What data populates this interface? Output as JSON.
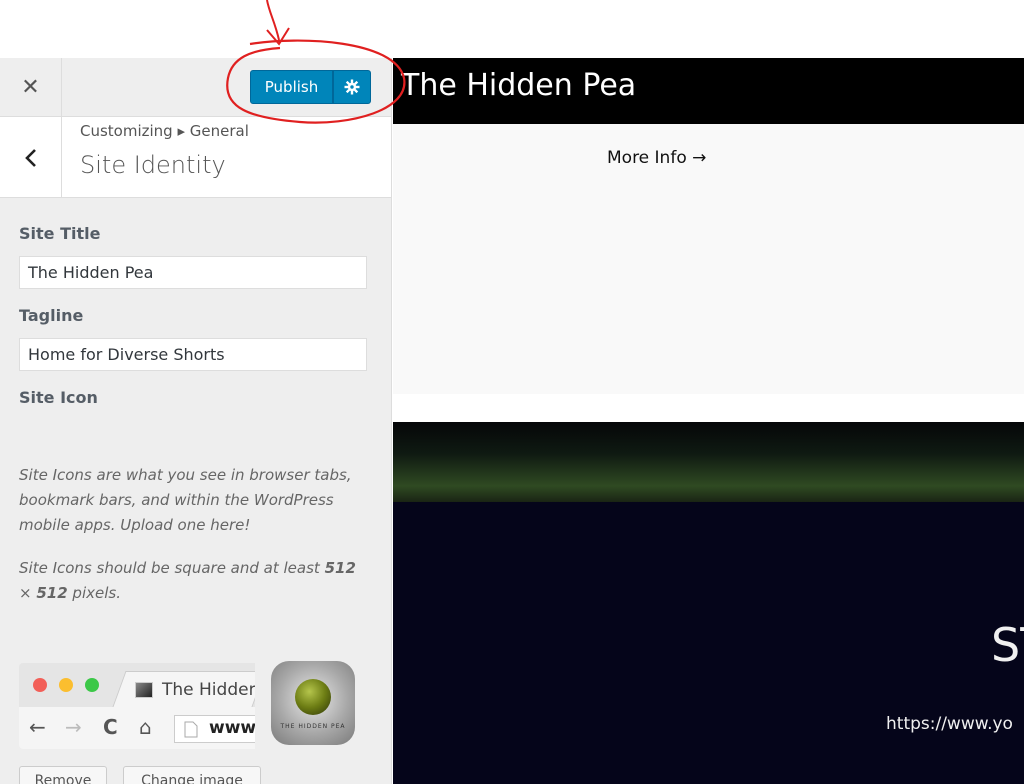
{
  "header": {
    "close_glyph": "✕",
    "publish_label": "Publish",
    "settings_icon": "gear-icon"
  },
  "section": {
    "breadcrumb": "Customizing ▸ General",
    "title": "Site Identity"
  },
  "fields": {
    "site_title_label": "Site Title",
    "site_title_value": "The Hidden Pea",
    "tagline_label": "Tagline",
    "tagline_value": "Home for Diverse Shorts",
    "site_icon_label": "Site Icon"
  },
  "site_icon": {
    "desc1": "Site Icons are what you see in browser tabs, bookmark bars, and within the WordPress mobile apps. Upload one here!",
    "desc2_pre": "Site Icons should be square and at least ",
    "desc2_size_a": "512",
    "desc2_times": " × ",
    "desc2_size_b": "512",
    "desc2_post": " pixels.",
    "tab_title": "The Hidden",
    "address": "www.",
    "app_icon_text": "THE HIDDEN PEA",
    "remove_label": "Remove",
    "change_label": "Change image"
  },
  "preview": {
    "site_title": "The Hidden Pea",
    "more_info": "More Info →",
    "hero_heading": "ST",
    "hero_url": "https://www.yo"
  },
  "colors": {
    "publish": "#0085ba",
    "sidebar_bg": "#eeeeee",
    "annotation": "#e02020"
  }
}
